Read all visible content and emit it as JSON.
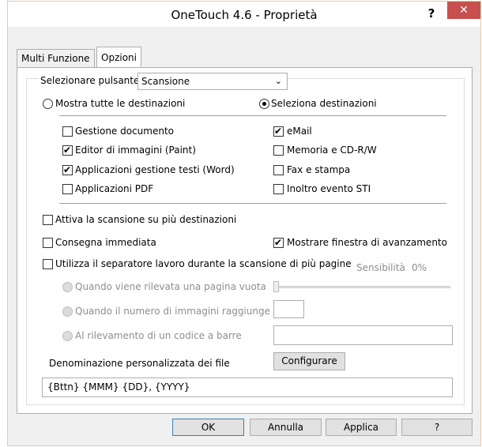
{
  "window": {
    "title": "OneTouch 4.6 - Proprietà",
    "help_glyph": "?",
    "close_glyph": "✕",
    "close_color": "#c7504e"
  },
  "tabs": [
    {
      "label": "Multi Funzione",
      "active": false
    },
    {
      "label": "Opzioni",
      "active": true
    }
  ],
  "button_select": {
    "label": "Selezionare pulsante:",
    "value": "Scansione"
  },
  "destinations_mode": {
    "show_all_label": "Mostra tutte le destinazioni",
    "show_all_selected": false,
    "select_label": "Seleziona destinazioni",
    "select_selected": true
  },
  "destinations": {
    "left": [
      {
        "label": "Gestione documento",
        "checked": false
      },
      {
        "label": "Editor di immagini (Paint)",
        "checked": true
      },
      {
        "label": "Applicazioni gestione testi (Word)",
        "checked": true
      },
      {
        "label": "Applicazioni  PDF",
        "checked": false
      }
    ],
    "right": [
      {
        "label": "eMail",
        "checked": true
      },
      {
        "label": "Memoria e CD-R/W",
        "checked": false
      },
      {
        "label": "Fax e stampa",
        "checked": false
      },
      {
        "label": "Inoltro evento STI",
        "checked": false
      }
    ]
  },
  "options": {
    "multi_dest": {
      "label": "Attiva la scansione su più destinazioni",
      "checked": false
    },
    "instant": {
      "label": "Consegna immediata",
      "checked": false
    },
    "progress": {
      "label": "Mostrare finestra di avanzamento",
      "checked": true
    },
    "separator": {
      "label": "Utilizza il separatore lavoro durante la scansione di più pagine",
      "checked": false
    },
    "sensitivity_label": "Sensibilità",
    "sensitivity_value": "0%",
    "sensitivity_level": 0
  },
  "separator_modes": [
    {
      "label": "Quando viene rilevata una pagina vuota"
    },
    {
      "label": "Quando il numero di immagini raggiunge"
    },
    {
      "label": "Al rilevamento di un codice a barre"
    }
  ],
  "file_naming": {
    "label": "Denominazione personalizzata dei file",
    "configure_label": "Configurare",
    "pattern": "{Bttn} {MMM} {DD}, {YYYY}"
  },
  "footer": {
    "ok": "OK",
    "cancel": "Annulla",
    "apply": "Applica",
    "help": "?"
  }
}
